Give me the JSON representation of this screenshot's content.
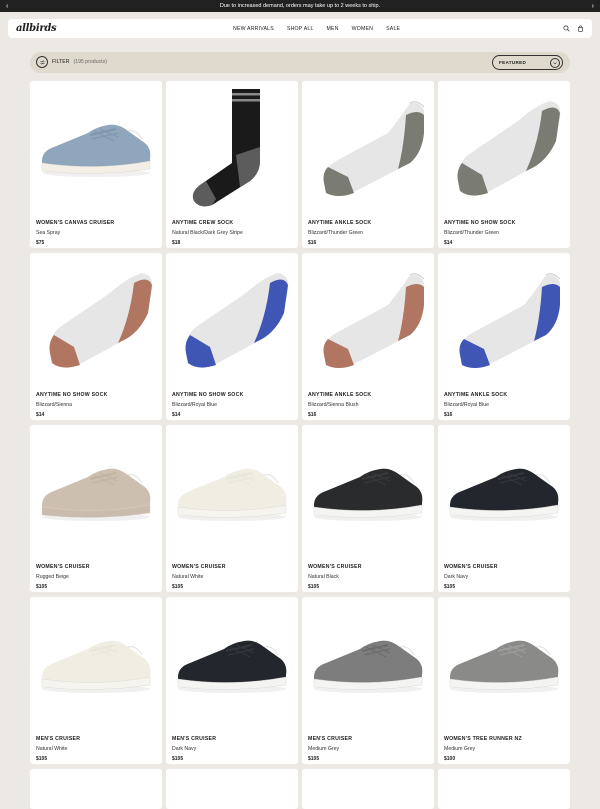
{
  "announcement": "Due to increased demand, orders may take up to 2 weeks to ship.",
  "nav": {
    "logo": "allbirds",
    "links": [
      "NEW ARRIVALS",
      "SHOP ALL",
      "MEN",
      "WOMEN",
      "SALE"
    ]
  },
  "filter": {
    "label": "FILTER",
    "count": "(195 products)",
    "sort_label": "FEATURED"
  },
  "products": [
    {
      "name": "Women's Canvas Cruiser",
      "color": "Sea Spray",
      "price": "$75",
      "kind": "shoe",
      "upper": "#8fa6bd",
      "sole": "#f3efe6",
      "lace": "#7f97ad"
    },
    {
      "name": "Anytime Crew Sock",
      "color": "Natural Black/Dark Grey Stripe",
      "price": "$18",
      "kind": "crew",
      "upper": "#1a1a1a",
      "accent": "#5c5c5c",
      "stripe": "#8a8a8a"
    },
    {
      "name": "Anytime Ankle Sock",
      "color": "Blizzard/Thunder Green",
      "price": "$16",
      "kind": "ankle",
      "upper": "#e6e6e6",
      "accent": "#7a7b72"
    },
    {
      "name": "Anytime No Show Sock",
      "color": "Blizzard/Thunder Green",
      "price": "$14",
      "kind": "noshow",
      "upper": "#e6e6e6",
      "accent": "#7a7b72"
    },
    {
      "name": "Anytime No Show Sock",
      "color": "Blizzard/Sienna",
      "price": "$14",
      "kind": "noshow",
      "upper": "#e6e6e6",
      "accent": "#b07662"
    },
    {
      "name": "Anytime No Show Sock",
      "color": "Blizzard/Royal Blue",
      "price": "$14",
      "kind": "noshow",
      "upper": "#e6e6e6",
      "accent": "#3f56b5"
    },
    {
      "name": "Anytime Ankle Sock",
      "color": "Blizzard/Sienna Blush",
      "price": "$16",
      "kind": "ankle",
      "upper": "#e6e6e6",
      "accent": "#b07662"
    },
    {
      "name": "Anytime Ankle Sock",
      "color": "Blizzard/Royal Blue",
      "price": "$16",
      "kind": "ankle",
      "upper": "#e6e6e6",
      "accent": "#3f56b5"
    },
    {
      "name": "Women's Cruiser",
      "color": "Rugged Beige",
      "price": "$105",
      "kind": "shoe",
      "upper": "#cdbfb0",
      "sole": "#c9bcad",
      "lace": "#c2b4a4"
    },
    {
      "name": "Women's Cruiser",
      "color": "Natural White",
      "price": "$105",
      "kind": "shoe",
      "upper": "#f0ede3",
      "sole": "#f6f4ee",
      "lace": "#e9e5d9"
    },
    {
      "name": "Women's Cruiser",
      "color": "Natural Black",
      "price": "$105",
      "kind": "shoe",
      "upper": "#2a2b2d",
      "sole": "#f4f4f2",
      "lace": "#3a3a3a"
    },
    {
      "name": "Women's Cruiser",
      "color": "Dark Navy",
      "price": "$105",
      "kind": "shoe",
      "upper": "#23262d",
      "sole": "#f4f4f2",
      "lace": "#34373e"
    },
    {
      "name": "Men's Cruiser",
      "color": "Natural White",
      "price": "$105",
      "kind": "shoe",
      "upper": "#f0ede3",
      "sole": "#f6f4ee",
      "lace": "#e9e5d9"
    },
    {
      "name": "Men's Cruiser",
      "color": "Dark Navy",
      "price": "$105",
      "kind": "shoe",
      "upper": "#23262d",
      "sole": "#f4f4f2",
      "lace": "#34373e"
    },
    {
      "name": "Men's Cruiser",
      "color": "Medium Grey",
      "price": "$105",
      "kind": "shoe",
      "upper": "#7d7d7d",
      "sole": "#f4f4f2",
      "lace": "#6c6c6c"
    },
    {
      "name": "Women's Tree Runner NZ",
      "color": "Medium Grey",
      "price": "$100",
      "kind": "shoe",
      "upper": "#8a8a88",
      "sole": "#f4f4f2",
      "lace": "#9d9d9b"
    }
  ]
}
